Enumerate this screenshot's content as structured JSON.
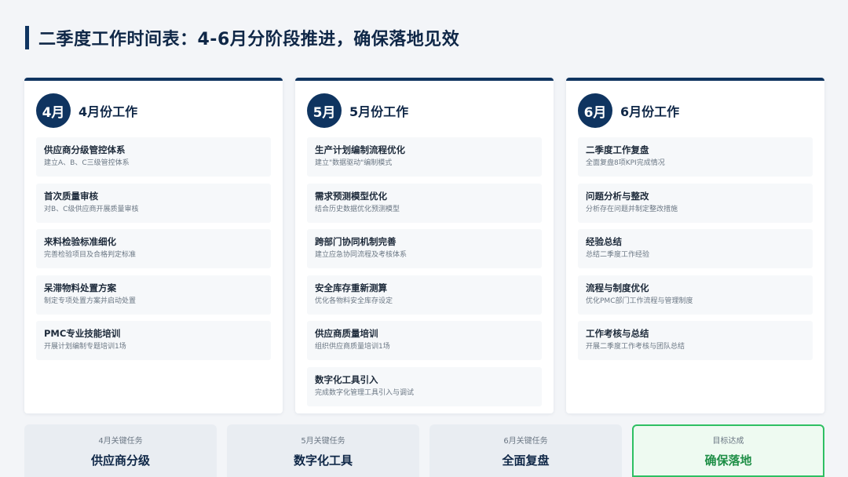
{
  "header": {
    "title": "二季度工作时间表：4-6月分阶段推进，确保落地见效"
  },
  "columns": [
    {
      "badge": "4月",
      "title": "4月份工作",
      "tasks": [
        {
          "name": "供应商分级管控体系",
          "desc": "建立A、B、C三级管控体系"
        },
        {
          "name": "首次质量审核",
          "desc": "对B、C级供应商开展质量审核"
        },
        {
          "name": "来料检验标准细化",
          "desc": "完善检验项目及合格判定标准"
        },
        {
          "name": "呆滞物料处置方案",
          "desc": "制定专项处置方案并启动处置"
        },
        {
          "name": "PMC专业技能培训",
          "desc": "开展计划编制专题培训1场"
        }
      ]
    },
    {
      "badge": "5月",
      "title": "5月份工作",
      "tasks": [
        {
          "name": "生产计划编制流程优化",
          "desc": "建立\"数据驱动\"编制模式"
        },
        {
          "name": "需求预测模型优化",
          "desc": "结合历史数据优化预测模型"
        },
        {
          "name": "跨部门协同机制完善",
          "desc": "建立应急协同流程及考核体系"
        },
        {
          "name": "安全库存重新测算",
          "desc": "优化各物料安全库存设定"
        },
        {
          "name": "供应商质量培训",
          "desc": "组织供应商质量培训1场"
        },
        {
          "name": "数字化工具引入",
          "desc": "完成数字化管理工具引入与调试"
        }
      ]
    },
    {
      "badge": "6月",
      "title": "6月份工作",
      "tasks": [
        {
          "name": "二季度工作复盘",
          "desc": "全面复盘8项KPI完成情况"
        },
        {
          "name": "问题分析与整改",
          "desc": "分析存在问题并制定整改措施"
        },
        {
          "name": "经验总结",
          "desc": "总结二季度工作经验"
        },
        {
          "name": "流程与制度优化",
          "desc": "优化PMC部门工作流程与管理制度"
        },
        {
          "name": "工作考核与总结",
          "desc": "开展二季度工作考核与团队总结"
        }
      ]
    }
  ],
  "summary": [
    {
      "label": "4月关键任务",
      "value": "供应商分级"
    },
    {
      "label": "5月关键任务",
      "value": "数字化工具"
    },
    {
      "label": "6月关键任务",
      "value": "全面复盘"
    },
    {
      "label": "目标达成",
      "value": "确保落地"
    }
  ],
  "colors": {
    "primary": "#0f3460",
    "goal_border": "#2fbf63",
    "goal_text": "#1f8f47"
  }
}
